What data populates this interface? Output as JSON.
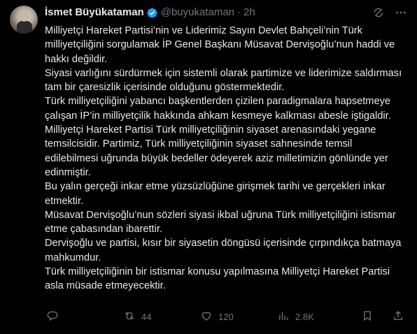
{
  "author": {
    "display_name": "İsmet Büyükataman",
    "handle": "@buyukataman",
    "separator": "·",
    "time": "2h"
  },
  "body_paragraphs": [
    "Milliyetçi Hareket Partisi’nin ve Liderimiz Sayın Devlet Bahçeli’nin Türk milliyetçiliğini sorgulamak İP Genel Başkanı Müsavat Dervişoğlu’nun haddi ve hakkı değildir.",
    "Siyasi varlığını sürdürmek için sistemli olarak partimize ve liderimize saldırması tam bir çaresizlik içerisinde olduğunu göstermektedir.",
    "Türk milliyetçiliğini yabancı başkentlerden çizilen paradigmalara hapsetmeye çalışan İP’in milliyetçilik hakkında ahkam kesmeye kalkması abesle iştigaldir.",
    "Milliyetçi Hareket Partisi Türk milliyetçiliğinin siyaset arenasındaki yegane temsilcisidir. Partimiz, Türk milliyetçiliğinin siyaset sahnesinde temsil edilebilmesi uğrunda büyük bedeller ödeyerek aziz milletimizin gönlünde yer edinmiştir.",
    "Bu yalın gerçeği inkar etme yüzsüzlüğüne girişmek tarihi ve gerçekleri inkar etmektir.",
    "Müsavat Dervişoğlu’nun sözleri siyasi ikbal uğruna Türk milliyetçiliğini istismar etme çabasından ibarettir.",
    "Dervişoğlu ve partisi, kısır bir siyasetin döngüsü içerisinde çırpındıkça batmaya mahkumdur.",
    "Türk milliyetçiliğinin bir istismar konusu yapılmasına Milliyetçi Hareket Partisi asla müsade etmeyecektir."
  ],
  "actions": {
    "replies": "",
    "retweets": "44",
    "likes": "120",
    "views": "2.8K"
  },
  "icons": {
    "verified": "verified-badge-icon",
    "grok": "grok-icon",
    "more": "more-icon",
    "reply": "reply-icon",
    "retweet": "retweet-icon",
    "like": "heart-icon",
    "views": "views-icon",
    "bookmark": "bookmark-icon",
    "share": "share-icon"
  },
  "colors": {
    "background": "#000000",
    "text": "#e7e9ea",
    "secondary": "#71767b",
    "verified": "#1d9bf0"
  }
}
